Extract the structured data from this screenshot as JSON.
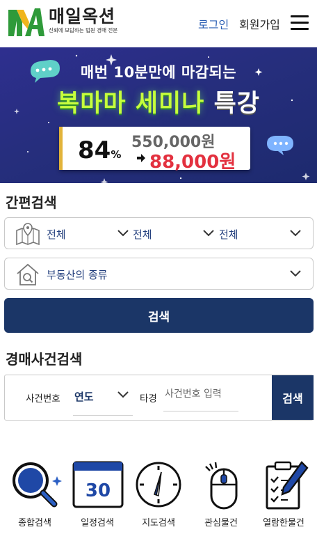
{
  "header": {
    "logo_name": "매일옥션",
    "logo_tagline": "신뢰에 보답하는 법원 경매 전문",
    "login_label": "로그인",
    "signup_label": "회원가입",
    "menu_icon": "hamburger-menu-icon"
  },
  "banner": {
    "line1": "매번 10분만에 마감되는",
    "line2_part1": "복마마 세미나",
    "line2_part2": "특강",
    "discount": "84",
    "discount_unit": "%",
    "original_price": "550,000원",
    "sale_price": "88,000원",
    "colors": {
      "background": "#262e7d",
      "accent_green": "#c6ff3c",
      "sale_red": "#e3313f"
    }
  },
  "quick_search": {
    "title": "간편검색",
    "region": [
      "전체",
      "전체",
      "전체"
    ],
    "property_type": "부동산의 종류",
    "search_label": "검색"
  },
  "case_search": {
    "title": "경매사건검색",
    "case_number_label": "사건번호",
    "year_value": "연도",
    "other_label": "타경",
    "case_input_placeholder": "사건번호 입력",
    "search_label": "검색"
  },
  "quick_menu": [
    {
      "label": "종합검색",
      "icon": "magnifier-icon"
    },
    {
      "label": "일정검색",
      "icon": "calendar-icon",
      "icon_text": "30"
    },
    {
      "label": "지도검색",
      "icon": "compass-icon"
    },
    {
      "label": "관심물건",
      "icon": "mouse-icon"
    },
    {
      "label": "열람한물건",
      "icon": "checklist-pen-icon"
    }
  ],
  "colors": {
    "primary": "#1b3667",
    "link_blue": "#2b5fb4"
  }
}
